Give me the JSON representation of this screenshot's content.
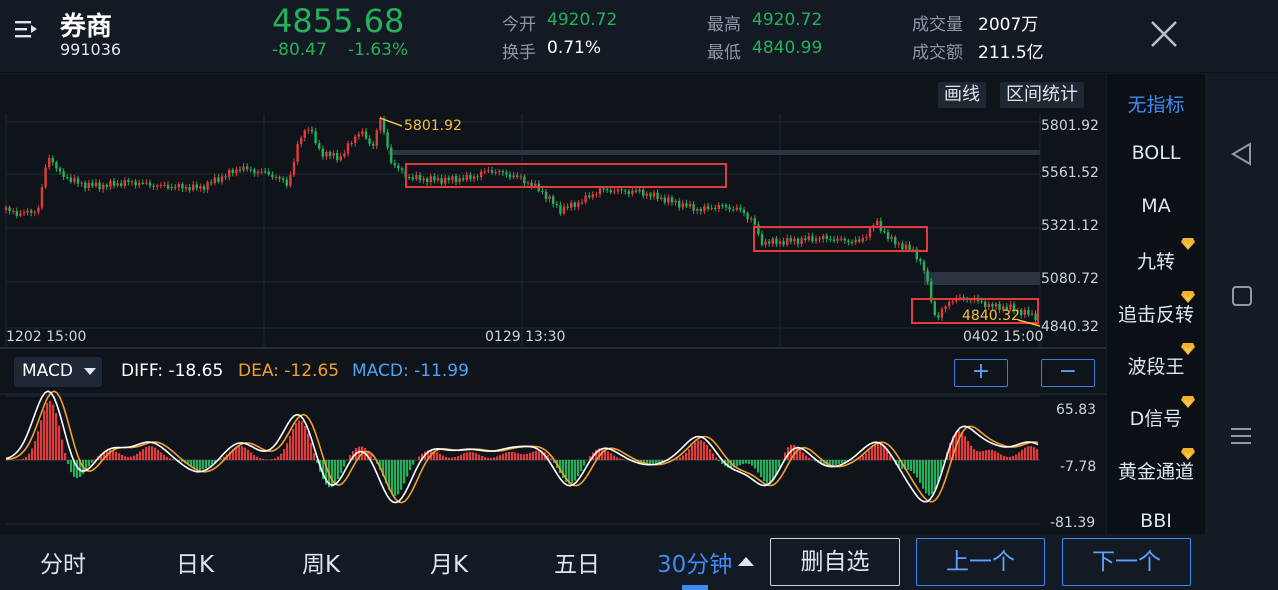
{
  "header": {
    "name": "券商",
    "code": "991036",
    "price": "4855.68",
    "change": "-80.47",
    "change_pct": "-1.63%",
    "open_label": "今开",
    "open_value": "4920.72",
    "turnover_label": "换手",
    "turnover_value": "0.71%",
    "high_label": "最高",
    "high_value": "4920.72",
    "low_label": "最低",
    "low_value": "4840.99",
    "volume_label": "成交量",
    "volume_value": "2007万",
    "amount_label": "成交额",
    "amount_value": "211.5亿"
  },
  "toolbar": {
    "draw_line": "画线",
    "range_stats": "区间统计"
  },
  "main_chart": {
    "y_ticks": [
      "5801.92",
      "5561.52",
      "5321.12",
      "5080.72",
      "4840.32"
    ],
    "x_ticks": [
      "1202 15:00",
      "0129 13:30",
      "0402 15:00"
    ],
    "max_label": "5801.92",
    "min_label": "4840.32"
  },
  "indicator": {
    "selector_label": "MACD",
    "diff": "DIFF: -18.65",
    "dea": "DEA: -12.65",
    "macd": "MACD: -11.99",
    "plus": "+",
    "minus": "−",
    "y_ticks": [
      "65.83",
      "-7.78",
      "-81.39"
    ]
  },
  "sidebar": {
    "items": [
      "无指标",
      "BOLL",
      "MA",
      "九转",
      "追击反转",
      "波段王",
      "D信号",
      "黄金通道",
      "BBI"
    ]
  },
  "bottom": {
    "tabs": [
      "分时",
      "日K",
      "周K",
      "月K",
      "五日",
      "30分钟"
    ],
    "remove_watchlist": "删自选",
    "prev": "上一个",
    "next": "下一个"
  },
  "colors": {
    "up": "#e03c3c",
    "down": "#25b05a",
    "accent": "#3d8bf2",
    "dea_line": "#f0a030",
    "diff_line": "#ffffff",
    "highlight_box": "#e03c3c"
  }
}
